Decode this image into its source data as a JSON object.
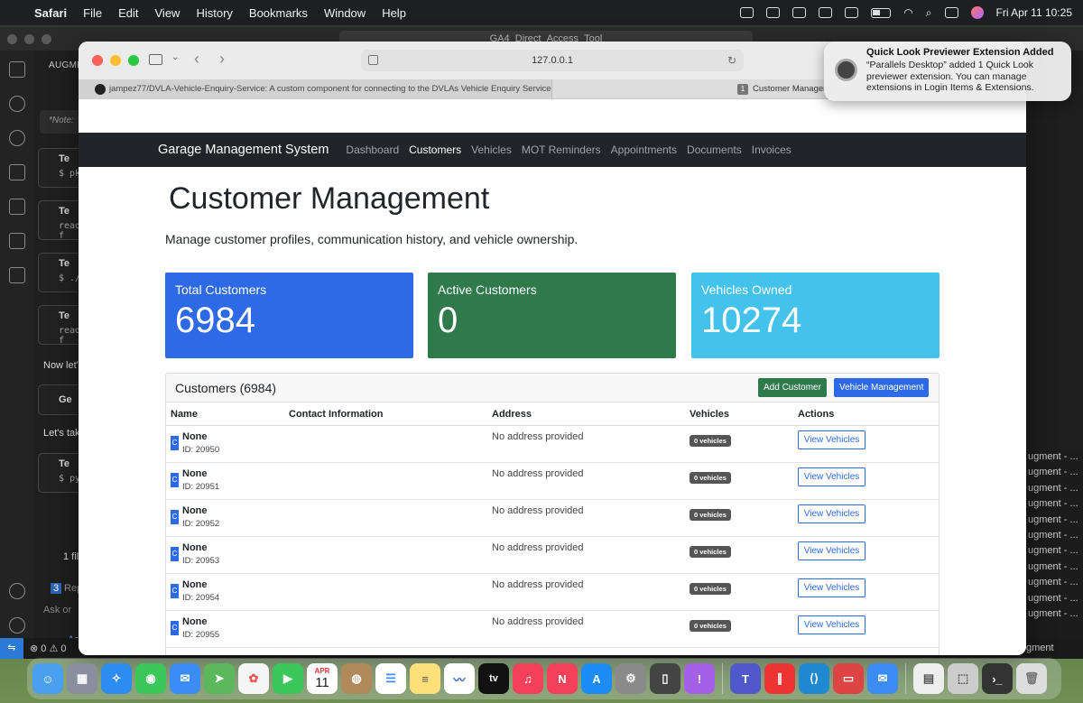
{
  "menubar": {
    "app_name": "Safari",
    "menus": [
      "File",
      "Edit",
      "View",
      "History",
      "Bookmarks",
      "Window",
      "Help"
    ],
    "datetime": "Fri Apr 11  10:25"
  },
  "vscode": {
    "search_text": "GA4_Direct_Access_Tool",
    "panel_label": "AUGME",
    "note_text": "*Note:",
    "cards": [
      {
        "title": "Te",
        "sub": "$ pki"
      },
      {
        "title": "Te",
        "sub": "read f"
      },
      {
        "title": "Te",
        "sub": "$ ./r"
      },
      {
        "title": "Te",
        "sub": "read f"
      }
    ],
    "text_now": "Now let'",
    "card_ge": "Ge",
    "text_lets": "Let's tak",
    "card_last": {
      "title": "Te",
      "sub": "$ pyt"
    },
    "files_label": "1 fil",
    "rep_badge": "3",
    "rep_label": "Rep",
    "ask_placeholder": "Ask or",
    "agent_label": "Ag",
    "right_lines": [
      "ugment - ...",
      "ugment - ...",
      "ugment - ...",
      "ugment - ...",
      "ugment - ...",
      "ugment - ...",
      "ugment - ...",
      "ugment - ...",
      "ugment - ...",
      "ugment - ...",
      "ugment - ..."
    ],
    "status_errors": "0",
    "status_warnings": "0",
    "status_right": "gment"
  },
  "safari": {
    "url": "127.0.0.1",
    "tabs": [
      {
        "label": "jampez77/DVLA-Vehicle-Enquiry-Service: A custom component for connecting to the DVLAs Vehicle Enquiry Service..."
      },
      {
        "badge": "1",
        "label": "Customer Managem"
      }
    ]
  },
  "app": {
    "brand": "Garage Management System",
    "nav": [
      "Dashboard",
      "Customers",
      "Vehicles",
      "MOT Reminders",
      "Appointments",
      "Documents",
      "Invoices"
    ],
    "active_nav": "Customers",
    "title": "Customer Management",
    "subtitle": "Manage customer profiles, communication history, and vehicle ownership.",
    "stats": [
      {
        "label": "Total Customers",
        "value": "6984",
        "color": "#2f6ae6"
      },
      {
        "label": "Active Customers",
        "value": "0",
        "color": "#2e7a4a"
      },
      {
        "label": "Vehicles Owned",
        "value": "10274",
        "color": "#43c3ec"
      }
    ],
    "panel": {
      "title": "Customers (6984)",
      "add_button": "Add Customer",
      "vehicle_button": "Vehicle Management",
      "columns": [
        "Name",
        "Contact Information",
        "Address",
        "Vehicles",
        "Actions"
      ],
      "rows": [
        {
          "avatar": "C",
          "name": "None",
          "id": "ID: 20950",
          "address": "No address provided",
          "vehicles": "0 vehicles",
          "action": "View Vehicles"
        },
        {
          "avatar": "C",
          "name": "None",
          "id": "ID: 20951",
          "address": "No address provided",
          "vehicles": "0 vehicles",
          "action": "View Vehicles"
        },
        {
          "avatar": "C",
          "name": "None",
          "id": "ID: 20952",
          "address": "No address provided",
          "vehicles": "0 vehicles",
          "action": "View Vehicles"
        },
        {
          "avatar": "C",
          "name": "None",
          "id": "ID: 20953",
          "address": "No address provided",
          "vehicles": "0 vehicles",
          "action": "View Vehicles"
        },
        {
          "avatar": "C",
          "name": "None",
          "id": "ID: 20954",
          "address": "No address provided",
          "vehicles": "0 vehicles",
          "action": "View Vehicles"
        },
        {
          "avatar": "C",
          "name": "None",
          "id": "ID: 20955",
          "address": "No address provided",
          "vehicles": "0 vehicles",
          "action": "View Vehicles"
        }
      ]
    }
  },
  "notification": {
    "title": "Quick Look Previewer Extension Added",
    "body": "“Parallels Desktop” added 1 Quick Look previewer extension. You can manage extensions in Login Items & Extensions."
  },
  "dock": {
    "calendar_month": "APR",
    "calendar_day": "11",
    "appletv_label": "tv",
    "apps": [
      "finder-icon",
      "launchpad-icon",
      "safari-icon",
      "messages-icon",
      "mail-icon",
      "maps-icon",
      "photos-icon",
      "facetime-icon",
      "calendar-icon",
      "contacts-icon",
      "reminders-icon",
      "notes-icon",
      "freeform-icon",
      "appletv-icon",
      "music-icon",
      "news-icon",
      "appstore-icon",
      "settings-icon",
      "iphone-mirroring-icon",
      "feedback-icon",
      "teams-icon",
      "parallels-icon",
      "vscode-icon",
      "remote-desktop-icon",
      "mail2-icon",
      "preview-icon",
      "screenshot-icon",
      "terminal-icon",
      "trash-icon"
    ]
  }
}
